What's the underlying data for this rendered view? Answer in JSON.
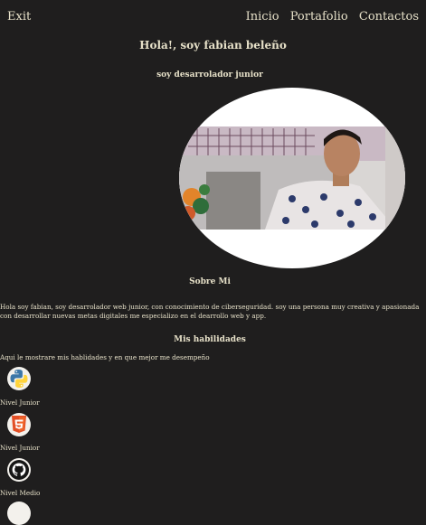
{
  "nav": {
    "exit": "Exit",
    "links": [
      "Inicio",
      "Portafolio",
      "Contactos"
    ]
  },
  "hero": {
    "title": "Hola!, soy fabian beleño",
    "subtitle": "soy desarrolador junior"
  },
  "about": {
    "heading": "Sobre Mi",
    "text": "Hola soy fabian, soy desarrolador web junior, con conocimiento de ciberseguridad. soy una persona muy creativa y apasionada con desarrollar nuevas metas digitales me especializo en el dearrollo web y app."
  },
  "skills": {
    "heading": "Mis habilidades",
    "intro": "Aqui le mostrare mis hablidades y en que mejor me desempeño",
    "items": [
      {
        "icon": "python-icon",
        "level": "Nivel Junior"
      },
      {
        "icon": "html5-icon",
        "level": "Nivel Junior"
      },
      {
        "icon": "github-icon",
        "level": "Nivel Medio"
      },
      {
        "icon": "skill-icon",
        "level": ""
      }
    ]
  },
  "colors": {
    "background": "#1f1e1e",
    "text": "#e6e0c8",
    "html5": "#e34f26",
    "python_blue": "#3b77a8",
    "python_yellow": "#ffd43b"
  }
}
